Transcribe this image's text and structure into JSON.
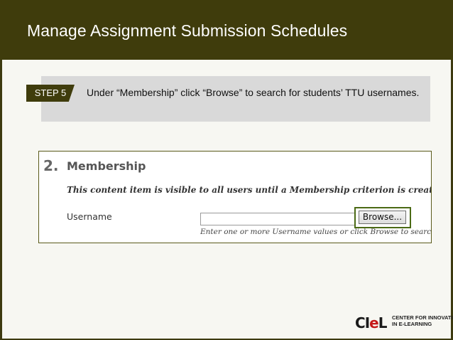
{
  "slide": {
    "title": "Manage Assignment Submission Schedules"
  },
  "step": {
    "badge": "STEP 5",
    "text": "Under “Membership” click “Browse” to search for students’ TTU usernames."
  },
  "screenshot": {
    "section_number": "2.",
    "section_title": "Membership",
    "info_text": "This content item is visible to all users until a Membership criterion is created. Users must b",
    "username_label": "Username",
    "username_value": "",
    "browse_label": "Browse...",
    "hint": "Enter one or more Username values or click Browse to search."
  },
  "logo": {
    "mark_c": "C",
    "mark_i": "I",
    "mark_e": "e",
    "mark_l": "L",
    "line1": "CENTER FOR INNOVATION",
    "line2": "IN E-LEARNING"
  },
  "colors": {
    "header_bg": "#3f3c0c",
    "banner_bg": "#d9d9d9",
    "highlight_border": "#4b6a15",
    "logo_accent": "#c41818"
  }
}
